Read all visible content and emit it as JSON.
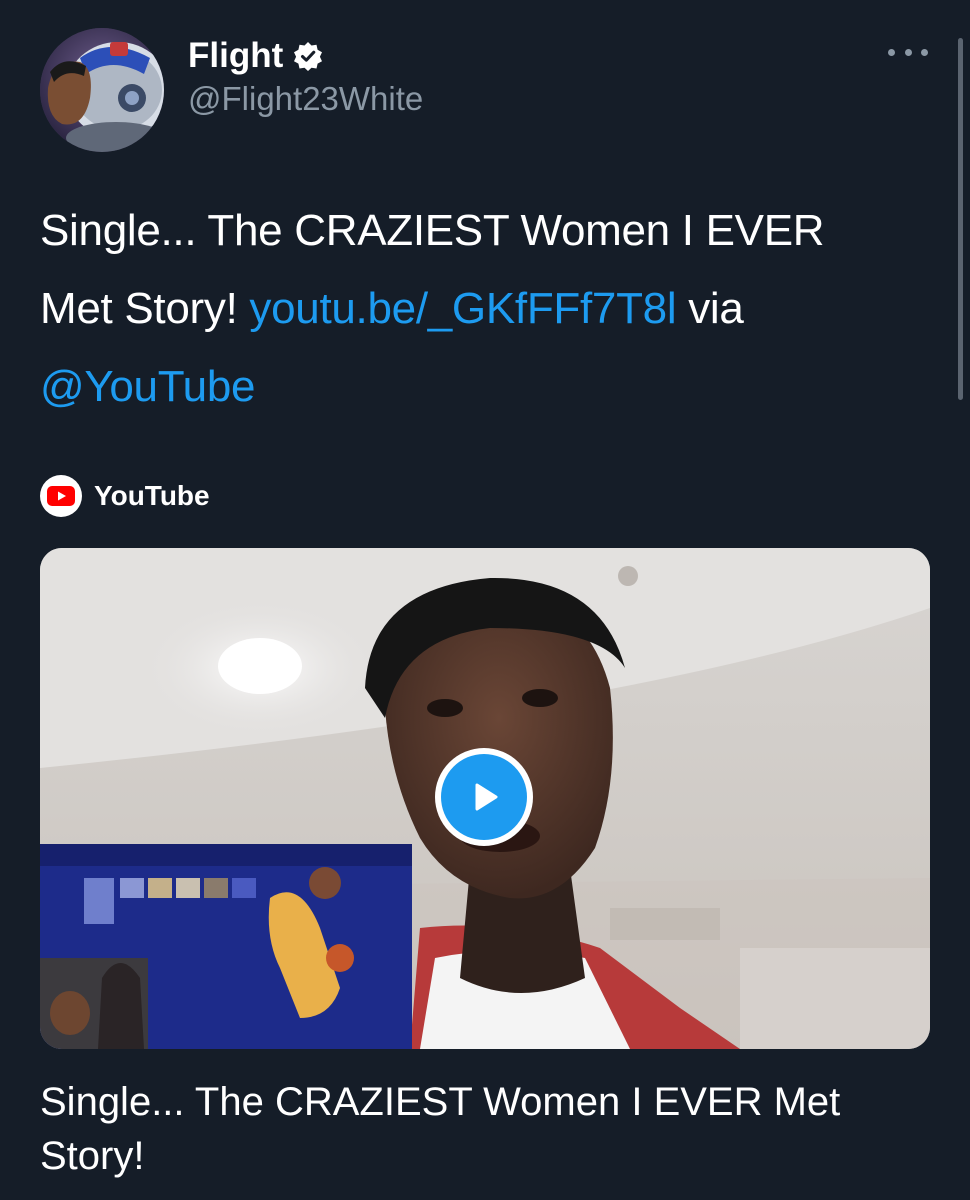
{
  "author": {
    "name": "Flight",
    "handle": "@Flight23White",
    "verified": true,
    "avatar": "astronaut-helmet-avatar"
  },
  "tweet": {
    "text_plain_1": "Single... The CRAZIEST Women I EVER Met Story! ",
    "link_1": "youtu.be/_GKfFFf7T8l",
    "text_plain_2": " via ",
    "mention": "@YouTube"
  },
  "card": {
    "source_icon": "youtube-icon",
    "source_label": "YouTube",
    "thumbnail": "video-thumbnail",
    "title": "Single... The CRAZIEST Women I EVER Met Story!"
  },
  "icons": {
    "more": "more-options-icon",
    "verified": "verified-badge-icon",
    "play": "play-icon"
  },
  "colors": {
    "background": "#151d28",
    "text": "#ffffff",
    "secondary": "#8b98a5",
    "link": "#1d9bf0",
    "youtube_red": "#ff0000"
  }
}
